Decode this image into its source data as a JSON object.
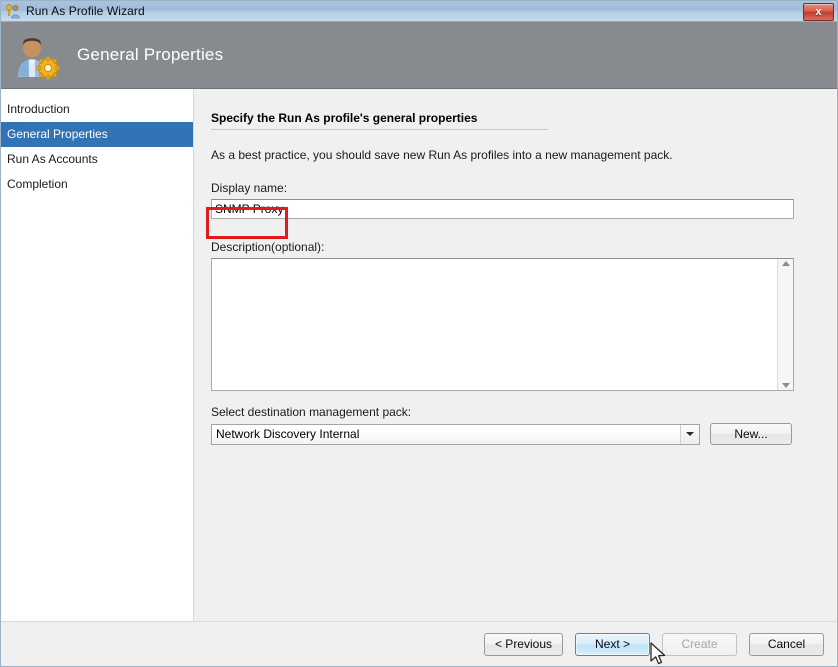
{
  "window": {
    "title": "Run As Profile Wizard",
    "title_icon": "runas-profile-icon",
    "close_label": "x"
  },
  "banner": {
    "title": "General Properties",
    "icon": "user-gear-icon",
    "background": "#878b8f"
  },
  "sidebar": {
    "items": [
      {
        "label": "Introduction",
        "active": false
      },
      {
        "label": "General Properties",
        "active": true
      },
      {
        "label": "Run As Accounts",
        "active": false
      },
      {
        "label": "Completion",
        "active": false
      }
    ],
    "active_color": "#3273b5"
  },
  "main": {
    "section_title": "Specify the Run As profile's general properties",
    "best_practice": "As a best practice, you should save new Run As profiles into a new management pack.",
    "display_name": {
      "label": "Display name:",
      "value": "SNMP Proxy",
      "placeholder": ""
    },
    "description": {
      "label": "Description(optional):",
      "value": "",
      "placeholder": ""
    },
    "management_pack": {
      "label": "Select destination management pack:",
      "selected": "Network Discovery Internal",
      "new_button": "New..."
    }
  },
  "annotation": {
    "color": "#e01b1b",
    "target": "display-name-input"
  },
  "footer": {
    "previous_label": "< Previous",
    "next_label": "Next >",
    "create_label": "Create",
    "cancel_label": "Cancel"
  }
}
